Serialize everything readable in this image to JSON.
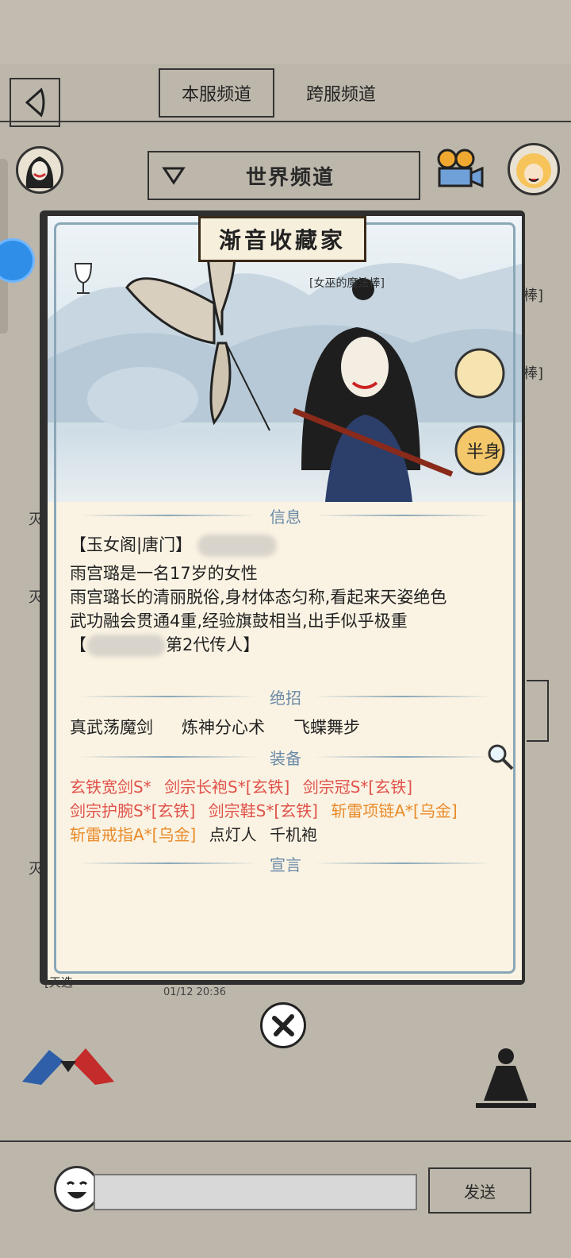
{
  "tabs": [
    {
      "label": "本服频道",
      "active": true
    },
    {
      "label": "跨服频道",
      "active": false
    }
  ],
  "channel": {
    "label": "世界频道"
  },
  "card": {
    "title": "渐音收藏家",
    "weapon_tag": "[女巫的魔法棒]",
    "sections": {
      "info": "信息",
      "skills": "绝招",
      "equipment": "装备",
      "declaration": "宣言"
    },
    "info_lines": [
      "【玉女阁|唐门】",
      "雨宫璐是一名17岁的女性",
      "雨宫璐长的清丽脱俗,身材体态匀称,看起来天姿绝色",
      "武功融会贯通4重,经验旗鼓相当,出手似乎极重",
      "第2代传人】"
    ],
    "info_prefix": "【",
    "skills": [
      "真武荡魔剑",
      "炼神分心术",
      "飞蝶舞步"
    ],
    "equipment": [
      {
        "text": "玄铁宽剑S*",
        "color": "#e0524a"
      },
      {
        "text": "剑宗长袍S*[玄铁]",
        "color": "#e0524a"
      },
      {
        "text": "剑宗冠S*[玄铁]",
        "color": "#e0524a"
      },
      {
        "text": "剑宗护腕S*[玄铁]",
        "color": "#e0524a"
      },
      {
        "text": "剑宗鞋S*[玄铁]",
        "color": "#e0524a"
      },
      {
        "text": "斩雷项链A*[乌金]",
        "color": "#e98b2a"
      },
      {
        "text": "斩雷戒指A*[乌金]",
        "color": "#e98b2a"
      },
      {
        "text": "点灯人",
        "color": "#222222"
      },
      {
        "text": "千机袍",
        "color": "#222222"
      }
    ]
  },
  "background": {
    "tag": "[天选",
    "timestamp": "01/12 20:36"
  },
  "footer": {
    "send_label": "发送",
    "input_placeholder": ""
  },
  "icons": [
    "back-icon",
    "dropdown-triangle-icon",
    "camera-icon",
    "close-x-icon",
    "magnify-icon",
    "emoji-icon",
    "goblet-icon"
  ]
}
